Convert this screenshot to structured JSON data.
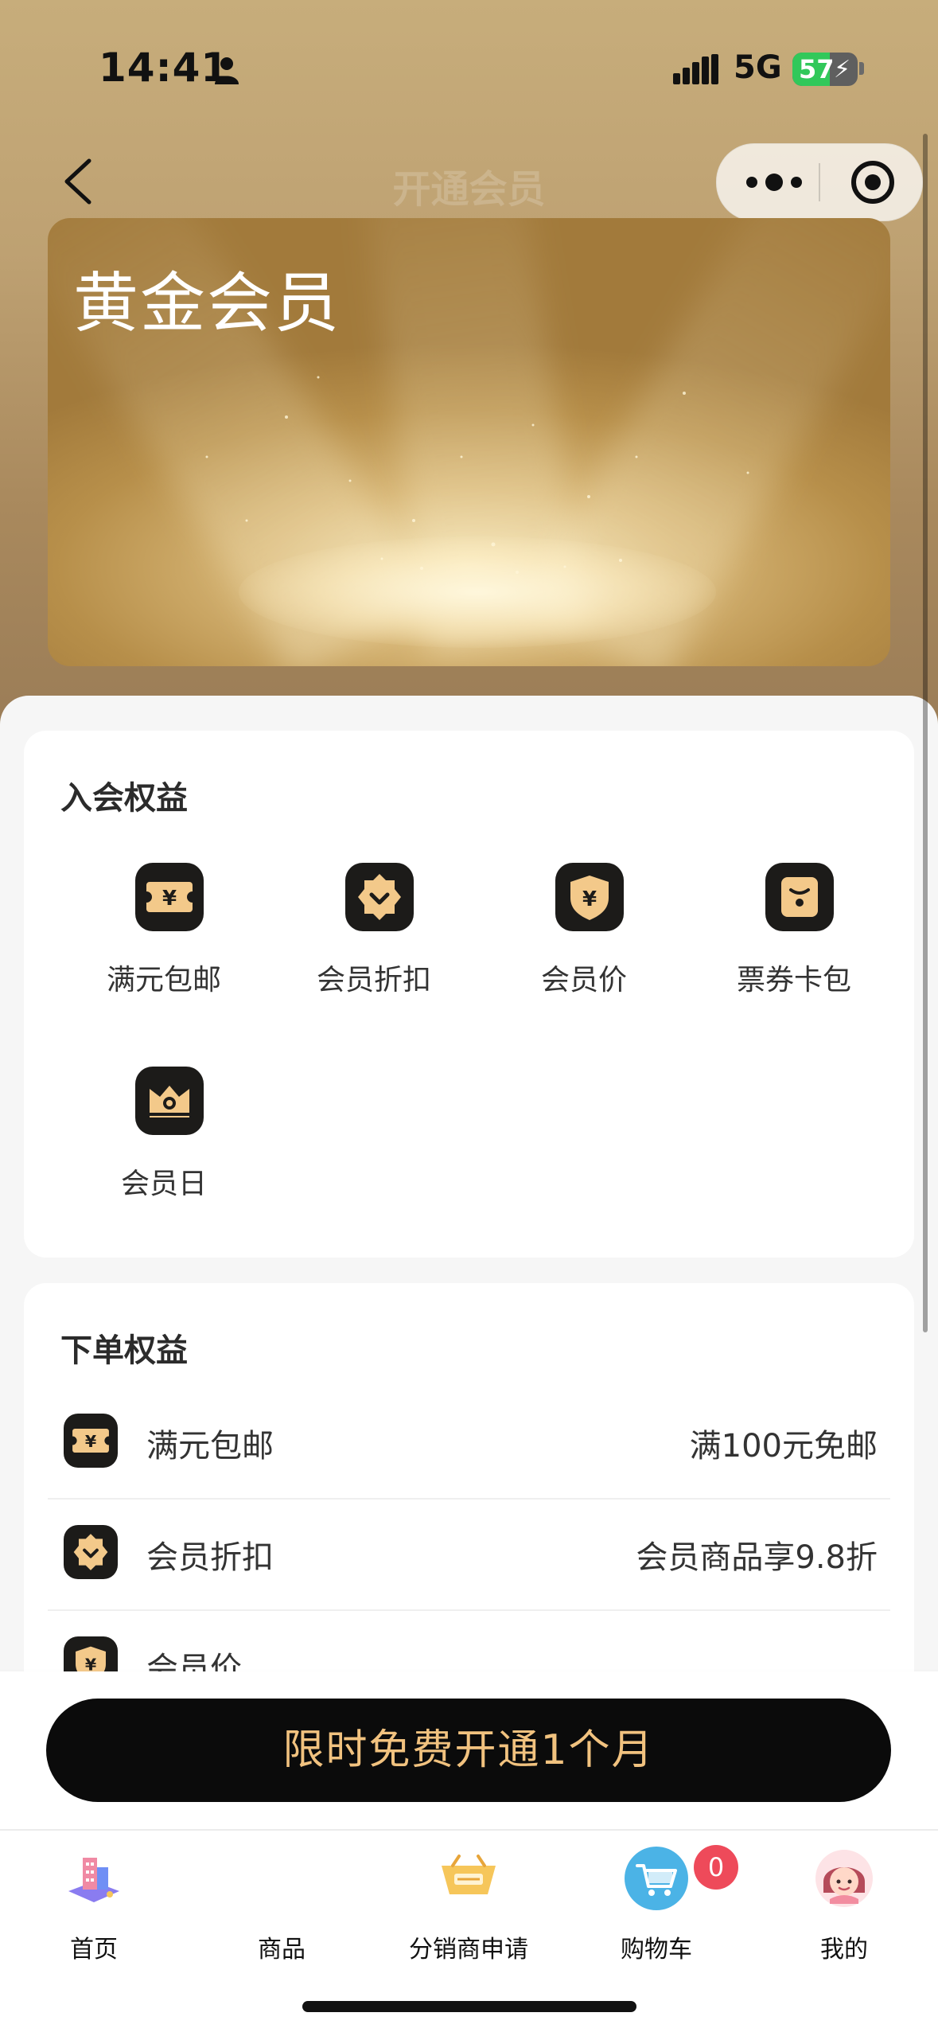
{
  "status_bar": {
    "time": "14:41",
    "network": "5G",
    "battery": "57",
    "battery_fraction": 0.57
  },
  "nav": {
    "title": "开通会员"
  },
  "card": {
    "title": "黄金会员"
  },
  "join_benefits": {
    "title": "入会权益",
    "items": [
      {
        "label": "满元包邮",
        "icon": "yuan-ticket-icon"
      },
      {
        "label": "会员折扣",
        "icon": "discount-badge-icon"
      },
      {
        "label": "会员价",
        "icon": "yuan-shield-icon"
      },
      {
        "label": "票券卡包",
        "icon": "coupon-wallet-icon"
      },
      {
        "label": "会员日",
        "icon": "crown-icon"
      }
    ]
  },
  "order_benefits": {
    "title": "下单权益",
    "rows": [
      {
        "name": "满元包邮",
        "value": "满100元免邮",
        "icon": "yuan-ticket-icon"
      },
      {
        "name": "会员折扣",
        "value": "会员商品享9.8折",
        "icon": "discount-badge-icon"
      },
      {
        "name": "会员价",
        "value": "",
        "icon": "yuan-shield-icon"
      }
    ]
  },
  "cta": {
    "label": "限时免费开通1个月"
  },
  "tabbar": {
    "items": [
      {
        "label": "首页",
        "icon": "home-building-icon"
      },
      {
        "label": "商品",
        "icon": ""
      },
      {
        "label": "分销商申请",
        "icon": "distributor-icon"
      },
      {
        "label": "购物车",
        "icon": "shopping-cart-icon"
      },
      {
        "label": "我的",
        "icon": "user-avatar-icon"
      }
    ],
    "cart_badge": "0"
  },
  "colors": {
    "gold": "#f1c27f",
    "icon_bg": "#1c1b19",
    "cta_bg": "#0b0b0b",
    "badge": "#ee4a5a"
  }
}
